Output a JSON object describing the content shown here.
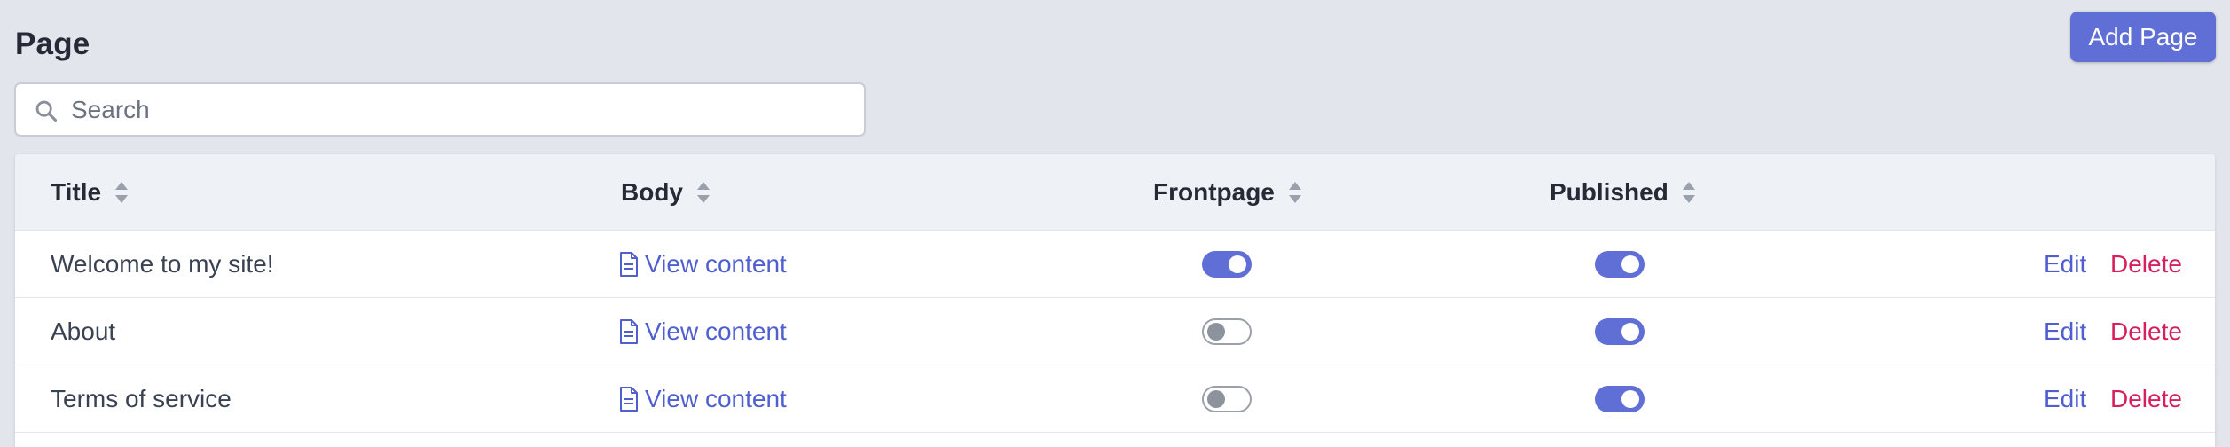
{
  "header": {
    "title": "Page",
    "add_button_label": "Add Page"
  },
  "search": {
    "placeholder": "Search",
    "value": ""
  },
  "table": {
    "columns": [
      {
        "key": "title",
        "label": "Title",
        "sortable": true
      },
      {
        "key": "body",
        "label": "Body",
        "sortable": true
      },
      {
        "key": "frontpage",
        "label": "Frontpage",
        "sortable": true
      },
      {
        "key": "published",
        "label": "Published",
        "sortable": true
      }
    ],
    "rows": [
      {
        "title": "Welcome to my site!",
        "body_link": "View content",
        "frontpage": true,
        "published": true,
        "edit_label": "Edit",
        "delete_label": "Delete"
      },
      {
        "title": "About",
        "body_link": "View content",
        "frontpage": false,
        "published": true,
        "edit_label": "Edit",
        "delete_label": "Delete"
      },
      {
        "title": "Terms of service",
        "body_link": "View content",
        "frontpage": false,
        "published": true,
        "edit_label": "Edit",
        "delete_label": "Delete"
      }
    ]
  },
  "icons": {
    "search": "search-icon",
    "sort": "sort-icon",
    "document": "document-icon"
  },
  "colors": {
    "accent": "#5f6fd6",
    "link": "#4f5fcf",
    "danger": "#d61f5e",
    "background": "#e2e5ec",
    "header_bg": "#eef1f5"
  }
}
